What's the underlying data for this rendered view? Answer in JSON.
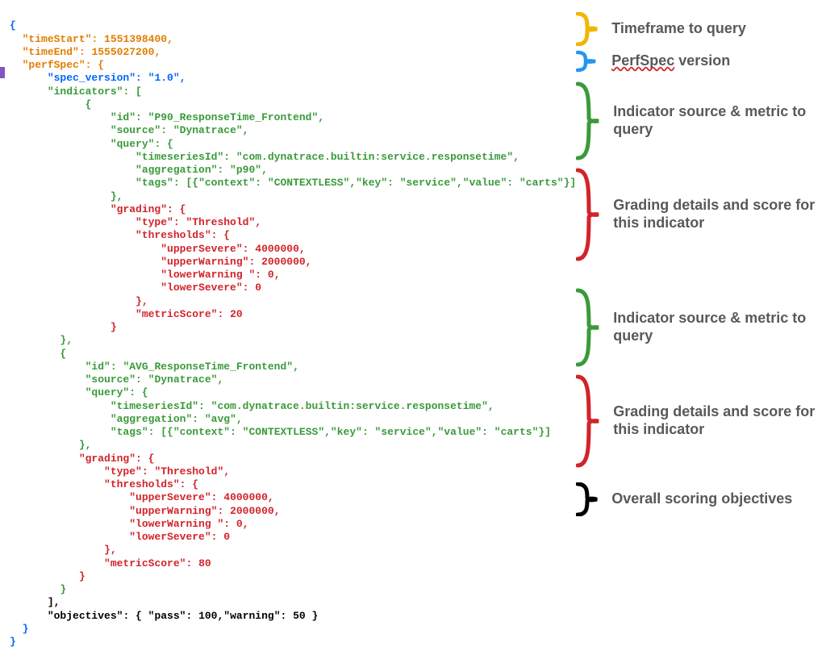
{
  "json": {
    "timeStart": 1551398400,
    "timeEnd": 1555027200,
    "spec_version": "1.0",
    "indicator1": {
      "id": "P90_ResponseTime_Frontend",
      "source": "Dynatrace",
      "timeseriesId": "com.dynatrace.builtin:service.responsetime",
      "aggregation": "p90",
      "tags_context": "CONTEXTLESS",
      "tags_key": "service",
      "tags_value": "carts",
      "grading_type": "Threshold",
      "upperSevere": 4000000,
      "upperWarning": 2000000,
      "lowerWarning": 0,
      "lowerSevere": 0,
      "metricScore": 20
    },
    "indicator2": {
      "id": "AVG_ResponseTime_Frontend",
      "source": "Dynatrace",
      "timeseriesId": "com.dynatrace.builtin:service.responsetime",
      "aggregation": "avg",
      "tags_context": "CONTEXTLESS",
      "tags_key": "service",
      "tags_value": "carts",
      "grading_type": "Threshold",
      "upperSevere": 4000000,
      "upperWarning": 2000000,
      "lowerWarning": 0,
      "lowerSevere": 0,
      "metricScore": 80
    },
    "objectives_pass": 100,
    "objectives_warning": 50
  },
  "labels": {
    "keys": {
      "timeStart": "\"timeStart\"",
      "timeEnd": "\"timeEnd\"",
      "perfSpec": "\"perfSpec\"",
      "spec_version": "\"spec_version\"",
      "indicators": "\"indicators\"",
      "id": "\"id\"",
      "source": "\"source\"",
      "query": "\"query\"",
      "timeseriesId": "\"timeseriesId\"",
      "aggregation": "\"aggregation\"",
      "tags": "\"tags\"",
      "context": "\"context\"",
      "key": "\"key\"",
      "value": "\"value\"",
      "grading": "\"grading\"",
      "type": "\"type\"",
      "thresholds": "\"thresholds\"",
      "upperSevere": "\"upperSevere\"",
      "upperWarning": "\"upperWarning\"",
      "lowerWarning": "\"lowerWarning \"",
      "lowerSevere": "\"lowerSevere\"",
      "metricScore": "\"metricScore\"",
      "objectives": "\"objectives\"",
      "pass": "\"pass\"",
      "warning": "\"warning\""
    }
  },
  "annotations": {
    "timeframe": "Timeframe to query",
    "perfspec_version_prefix": "PerfSpec",
    "perfspec_version_suffix": " version",
    "indicator_source": "Indicator source & metric to query",
    "grading": "Grading details and score for this indicator",
    "objectives": "Overall scoring objectives"
  }
}
